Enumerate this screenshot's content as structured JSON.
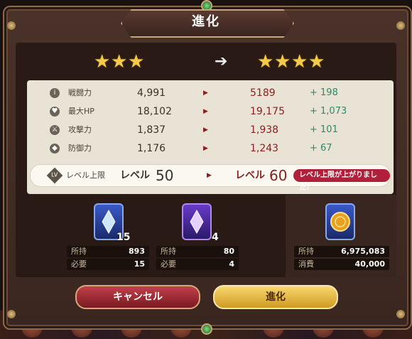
{
  "title": "進化",
  "stars": {
    "current": 3,
    "next": 4,
    "arrow": "➔"
  },
  "stats": [
    {
      "icon": "info-icon",
      "label": "戦闘力",
      "current": "4,991",
      "new": "5189",
      "diff": "+ 198"
    },
    {
      "icon": "heart-icon",
      "label": "最大HP",
      "current": "18,102",
      "new": "19,175",
      "diff": "+ 1,073"
    },
    {
      "icon": "sword-icon",
      "label": "攻撃力",
      "current": "1,837",
      "new": "1,938",
      "diff": "+ 101"
    },
    {
      "icon": "shield-icon",
      "label": "防御力",
      "current": "1,176",
      "new": "1,243",
      "diff": "+ 67"
    }
  ],
  "level": {
    "icon_text": "LV",
    "label": "レベル上限",
    "word": "レベル",
    "current": "50",
    "new": "60",
    "badge": "レベル上限が上がりました！"
  },
  "materials": [
    {
      "icon": "blue-crystal-icon",
      "count": "15",
      "owned_label": "所持",
      "owned": "893",
      "need_label": "必要",
      "need": "15"
    },
    {
      "icon": "purple-crystal-icon",
      "count": "4",
      "owned_label": "所持",
      "owned": "80",
      "need_label": "必要",
      "need": "4"
    }
  ],
  "currency": {
    "icon": "gold-coin-icon",
    "owned_label": "所持",
    "owned": "6,975,083",
    "cost_label": "消費",
    "cost": "40,000"
  },
  "buttons": {
    "cancel": "キャンセル",
    "evolve": "進化"
  },
  "arrow_glyph": "▶",
  "colors": {
    "accent_gold": "#f5c94a",
    "new_value_red": "#8a2020",
    "diff_green": "#2a8a6a",
    "badge_red": "#b0203a"
  }
}
